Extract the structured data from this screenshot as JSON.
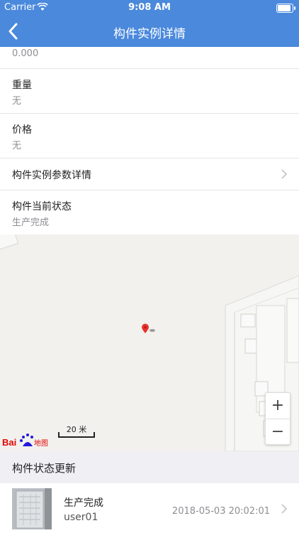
{
  "status_bar": {
    "carrier": "Carrier",
    "time": "9:08 AM",
    "battery_level": 1.0
  },
  "nav": {
    "title": "构件实例详情"
  },
  "fields": {
    "top_value": "0.000",
    "weight": {
      "label": "重量",
      "value": "无"
    },
    "price": {
      "label": "价格",
      "value": "无"
    },
    "params": {
      "label": "构件实例参数详情"
    },
    "status": {
      "label": "构件当前状态",
      "value": "生产完成"
    }
  },
  "map": {
    "scale_label": "20 米",
    "logo_text": "Bai地图",
    "zoom_in": "+",
    "zoom_out": "−"
  },
  "updates": {
    "header": "构件状态更新",
    "items": [
      {
        "status": "生产完成",
        "user": "user01",
        "time": "2018-05-03 20:02:01"
      }
    ]
  },
  "colors": {
    "nav_bg": "#4a89dc",
    "pin": "#e8322d"
  }
}
